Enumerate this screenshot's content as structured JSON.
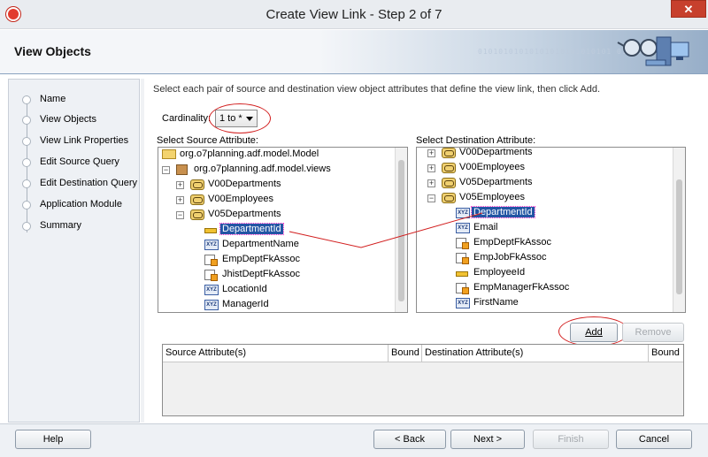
{
  "window": {
    "title": "Create View Link - Step 2 of 7",
    "close_glyph": "✕"
  },
  "header": {
    "title": "View Objects",
    "art_text": "01010101010101010101010101 010101010101"
  },
  "steps": [
    {
      "label": "Name",
      "state": "done"
    },
    {
      "label": "View Objects",
      "state": "current"
    },
    {
      "label": "View Link Properties",
      "state": "done"
    },
    {
      "label": "Edit Source Query",
      "state": "todo"
    },
    {
      "label": "Edit Destination Query",
      "state": "todo"
    },
    {
      "label": "Application Module",
      "state": "todo"
    },
    {
      "label": "Summary",
      "state": "todo"
    }
  ],
  "instruction": "Select each pair of source and destination view object attributes that define the view link, then click Add.",
  "cardinality": {
    "label": "Cardinality:",
    "value": "1 to *"
  },
  "source": {
    "label": "Select Source Attribute:",
    "rows": [
      {
        "text": "org.o7planning.adf.model.Model",
        "icon": "folder",
        "indent": 0,
        "exp": ""
      },
      {
        "text": "org.o7planning.adf.model.views",
        "icon": "pkg",
        "indent": 1,
        "exp": "−"
      },
      {
        "text": "V00Departments",
        "icon": "vo",
        "indent": 2,
        "exp": "+"
      },
      {
        "text": "V00Employees",
        "icon": "vo",
        "indent": 2,
        "exp": "+"
      },
      {
        "text": "V05Departments",
        "icon": "vo",
        "indent": 2,
        "exp": "−"
      },
      {
        "text": "DepartmentId",
        "icon": "key",
        "indent": 3,
        "exp": "",
        "selected": true
      },
      {
        "text": "DepartmentName",
        "icon": "xyz",
        "indent": 3,
        "exp": ""
      },
      {
        "text": "EmpDeptFkAssoc",
        "icon": "assoc",
        "indent": 3,
        "exp": ""
      },
      {
        "text": "JhistDeptFkAssoc",
        "icon": "assoc",
        "indent": 3,
        "exp": ""
      },
      {
        "text": "LocationId",
        "icon": "xyz",
        "indent": 3,
        "exp": ""
      },
      {
        "text": "ManagerId",
        "icon": "xyz",
        "indent": 3,
        "exp": ""
      }
    ]
  },
  "destination": {
    "label": "Select Destination Attribute:",
    "rows": [
      {
        "text": "V00Departments",
        "icon": "vo",
        "indent": 0,
        "exp": "+"
      },
      {
        "text": "V00Employees",
        "icon": "vo",
        "indent": 0,
        "exp": "+"
      },
      {
        "text": "V05Departments",
        "icon": "vo",
        "indent": 0,
        "exp": "+"
      },
      {
        "text": "V05Employees",
        "icon": "vo",
        "indent": 0,
        "exp": "−"
      },
      {
        "text": "DepartmentId",
        "icon": "xyz",
        "indent": 1,
        "exp": "",
        "selected": true
      },
      {
        "text": "Email",
        "icon": "xyz",
        "indent": 1,
        "exp": ""
      },
      {
        "text": "EmpDeptFkAssoc",
        "icon": "assoc",
        "indent": 1,
        "exp": ""
      },
      {
        "text": "EmpJobFkAssoc",
        "icon": "assoc",
        "indent": 1,
        "exp": ""
      },
      {
        "text": "EmployeeId",
        "icon": "key",
        "indent": 1,
        "exp": ""
      },
      {
        "text": "EmpManagerFkAssoc",
        "icon": "assoc",
        "indent": 1,
        "exp": ""
      },
      {
        "text": "FirstName",
        "icon": "xyz",
        "indent": 1,
        "exp": ""
      }
    ]
  },
  "icon_text": {
    "xyz": "XYZ"
  },
  "buttons": {
    "add": "Add",
    "remove": "Remove",
    "help": "Help",
    "back": "< Back",
    "next": "Next >",
    "finish": "Finish",
    "cancel": "Cancel"
  },
  "table": {
    "headers": [
      "Source Attribute(s)",
      "Bound",
      "Destination Attribute(s)",
      "Bound"
    ]
  },
  "colors": {
    "annotation": "#d21e1e",
    "selection": "#2255a4",
    "accent": "#3a67c5"
  }
}
